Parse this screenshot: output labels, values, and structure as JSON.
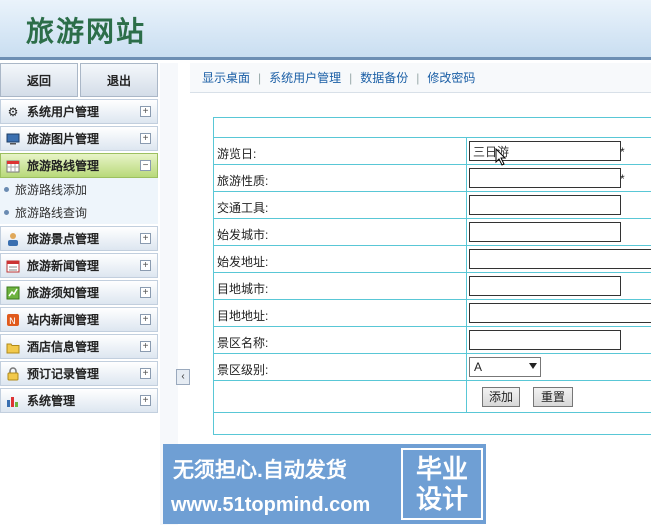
{
  "header": {
    "title": "旅游网站"
  },
  "sidebar": {
    "top_buttons": [
      {
        "label": "返回"
      },
      {
        "label": "退出"
      }
    ],
    "items": [
      {
        "label": "系统用户管理",
        "icon": "gear-icon",
        "toggle": "+"
      },
      {
        "label": "旅游图片管理",
        "icon": "monitor-icon",
        "toggle": "+"
      },
      {
        "label": "旅游路线管理",
        "icon": "calendar-icon",
        "toggle": "−"
      },
      {
        "label": "旅游景点管理",
        "icon": "person-icon",
        "toggle": "+"
      },
      {
        "label": "旅游新闻管理",
        "icon": "news-icon",
        "toggle": "+"
      },
      {
        "label": "旅游须知管理",
        "icon": "chart-icon",
        "toggle": "+"
      },
      {
        "label": "站内新闻管理",
        "icon": "news-badge-icon",
        "toggle": "+"
      },
      {
        "label": "酒店信息管理",
        "icon": "folder-icon",
        "toggle": "+"
      },
      {
        "label": "预订记录管理",
        "icon": "lock-icon",
        "toggle": "+"
      },
      {
        "label": "系统管理",
        "icon": "bar-chart-icon",
        "toggle": "+"
      }
    ],
    "submenu": [
      {
        "label": "旅游路线添加"
      },
      {
        "label": "旅游路线查询"
      }
    ],
    "collapse": "‹"
  },
  "topnav": {
    "links": [
      {
        "label": "显示桌面"
      },
      {
        "label": "系统用户管理"
      },
      {
        "label": "数据备份"
      },
      {
        "label": "修改密码"
      }
    ],
    "separator": "|"
  },
  "form": {
    "fields": [
      {
        "label": "游览日:",
        "value": "三日游",
        "required": "*"
      },
      {
        "label": "旅游性质:",
        "value": "",
        "required": "*"
      },
      {
        "label": "交通工具:",
        "value": ""
      },
      {
        "label": "始发城市:",
        "value": ""
      },
      {
        "label": "始发地址:",
        "value": ""
      },
      {
        "label": "目地城市:",
        "value": ""
      },
      {
        "label": "目地地址:",
        "value": ""
      },
      {
        "label": "景区名称:",
        "value": ""
      }
    ],
    "level": {
      "label": "景区级别:",
      "selected": "A"
    },
    "buttons": {
      "add": "添加",
      "reset": "重置"
    }
  },
  "banner": {
    "line1": "无须担心.自动发货",
    "line2": "www.51topmind.com",
    "box_line1": "毕业",
    "box_line2": "设计"
  }
}
